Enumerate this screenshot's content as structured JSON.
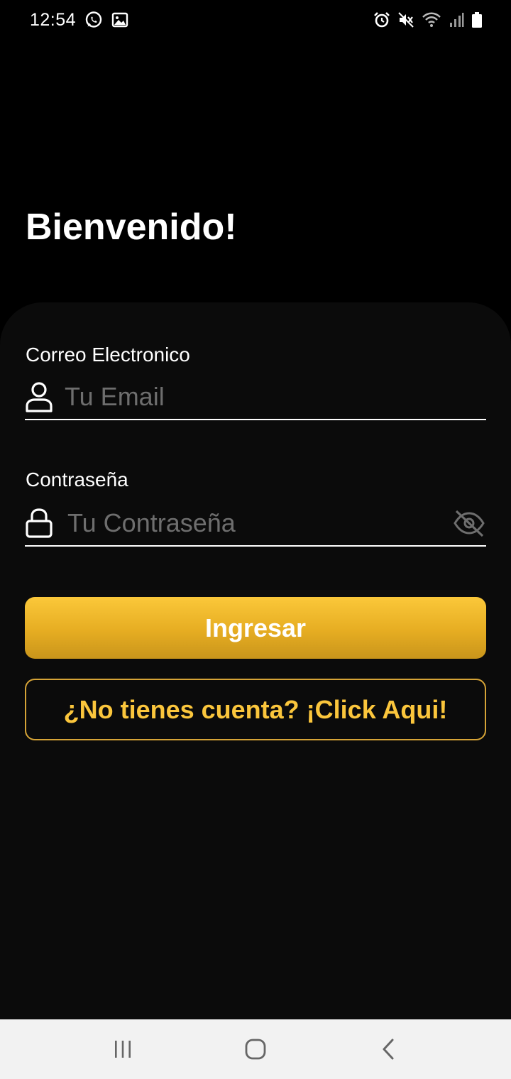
{
  "status_bar": {
    "time": "12:54",
    "left_icons": [
      "whatsapp-icon",
      "image-icon"
    ],
    "right_icons": [
      "alarm-icon",
      "mute-icon",
      "wifi-icon",
      "signal-icon",
      "battery-icon"
    ]
  },
  "welcome": {
    "title": "Bienvenido!"
  },
  "form": {
    "email": {
      "label": "Correo Electronico",
      "placeholder": "Tu Email",
      "value": "",
      "icon": "user-icon"
    },
    "password": {
      "label": "Contraseña",
      "placeholder": "Tu Contraseña",
      "value": "",
      "icon": "lock-icon",
      "toggle_icon": "eye-off-icon"
    },
    "login_button": "Ingresar",
    "register_button": "¿No tienes cuenta? ¡Click Aqui!"
  },
  "nav_bar": {
    "buttons": [
      "recent-apps-icon",
      "home-icon",
      "back-icon"
    ]
  },
  "colors": {
    "background": "#000000",
    "card": "#0b0b0b",
    "accent": "#fbc83a",
    "accent_text": "#fbc63c",
    "placeholder": "#6e6e6e",
    "nav_bar": "#f2f2f2"
  }
}
